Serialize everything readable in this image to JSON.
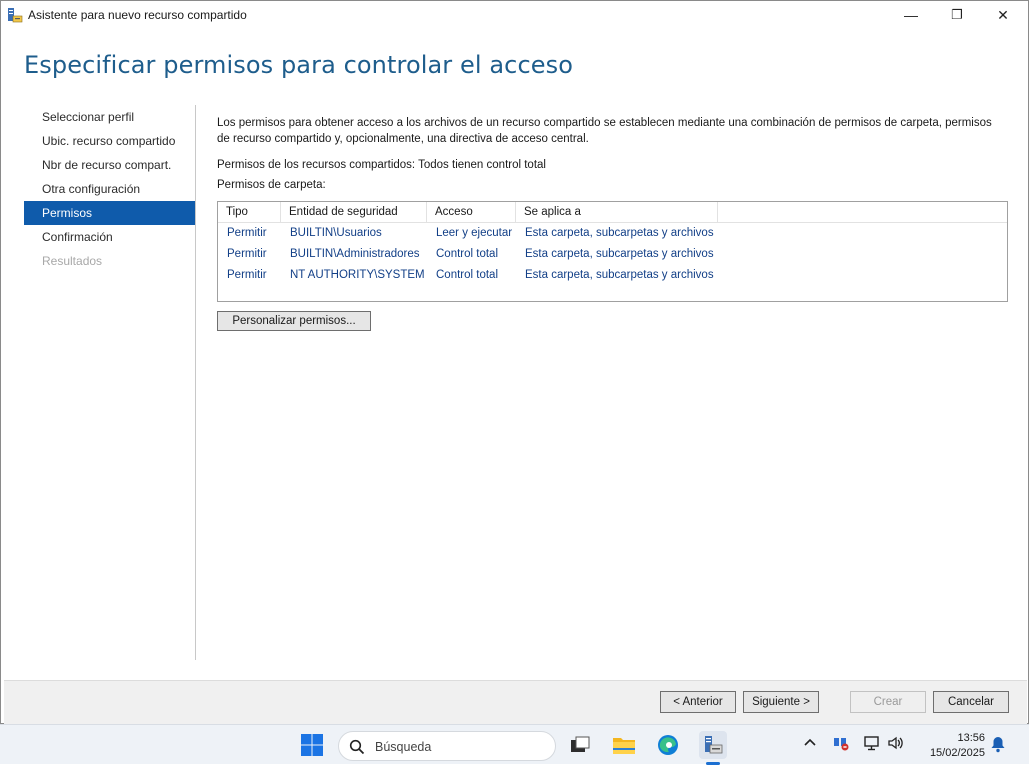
{
  "window": {
    "title": "Asistente para nuevo recurso compartido",
    "minimize": "—",
    "maximize": "❐",
    "close": "✕"
  },
  "page_title": "Especificar permisos para controlar el acceso",
  "nav": {
    "items": [
      {
        "label": "Seleccionar perfil",
        "state": "normal"
      },
      {
        "label": "Ubic. recurso compartido",
        "state": "normal"
      },
      {
        "label": "Nbr de recurso compart.",
        "state": "normal"
      },
      {
        "label": "Otra configuración",
        "state": "normal"
      },
      {
        "label": "Permisos",
        "state": "active"
      },
      {
        "label": "Confirmación",
        "state": "normal"
      },
      {
        "label": "Resultados",
        "state": "disabled"
      }
    ]
  },
  "content": {
    "description": "Los permisos para obtener acceso a los archivos de un recurso compartido se establecen mediante una combinación de permisos de carpeta, permisos de recurso compartido y, opcionalmente, una directiva de acceso central.",
    "share_permissions": "Permisos de los recursos compartidos: Todos tienen control total",
    "folder_permissions_label": "Permisos de carpeta:",
    "table": {
      "headers": [
        "Tipo",
        "Entidad de seguridad",
        "Acceso",
        "Se aplica a"
      ],
      "rows": [
        [
          "Permitir",
          "BUILTIN\\Usuarios",
          "Leer y ejecutar",
          "Esta carpeta, subcarpetas y archivos"
        ],
        [
          "Permitir",
          "BUILTIN\\Administradores",
          "Control total",
          "Esta carpeta, subcarpetas y archivos"
        ],
        [
          "Permitir",
          "NT AUTHORITY\\SYSTEM",
          "Control total",
          "Esta carpeta, subcarpetas y archivos"
        ]
      ]
    },
    "customize_button": "Personalizar permisos..."
  },
  "footer": {
    "previous": "< Anterior",
    "next": "Siguiente >",
    "create": "Crear",
    "cancel": "Cancelar"
  },
  "taskbar": {
    "search_placeholder": "Búsqueda",
    "time": "13:56",
    "date": "15/02/2025",
    "icons": [
      "windows-start-icon",
      "search-icon",
      "task-view-icon",
      "file-explorer-icon",
      "edge-icon",
      "server-manager-icon",
      "chevron-up-icon",
      "network-icon",
      "display-icon",
      "volume-icon",
      "notification-bell-icon"
    ]
  },
  "colors": {
    "heading": "#1e5d8c",
    "nav_active": "#0f5bab",
    "table_text": "#123f87"
  }
}
